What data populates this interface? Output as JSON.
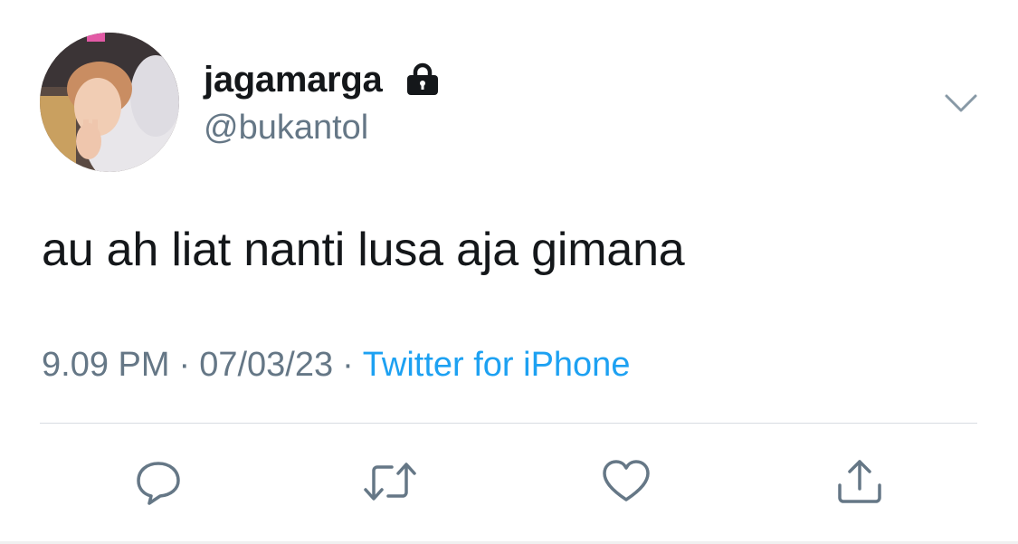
{
  "user": {
    "display_name": "jagamarga",
    "handle": "@bukantol",
    "protected_icon": "lock-icon",
    "avatar": "avatar-photo"
  },
  "tweet": {
    "text": "au ah liat nanti lusa aja gimana",
    "time": "9.09 PM",
    "date": "07/03/23",
    "separator": "·",
    "source": "Twitter for iPhone"
  },
  "menu": {
    "icon": "chevron-down-icon"
  },
  "actions": {
    "reply_icon": "reply-icon",
    "retweet_icon": "retweet-icon",
    "like_icon": "heart-icon",
    "share_icon": "share-icon"
  },
  "colors": {
    "text": "#14171a",
    "secondary": "#657786",
    "link": "#1da1f2",
    "icon": "#657786",
    "divider": "#d8dde2"
  }
}
